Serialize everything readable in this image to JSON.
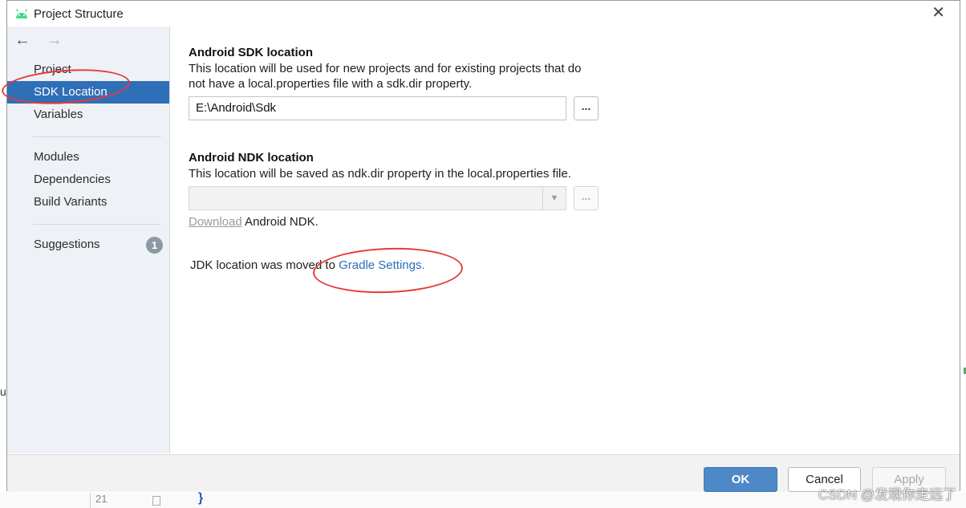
{
  "window": {
    "title": "Project Structure",
    "close_symbol": "✕"
  },
  "nav": {
    "back_symbol": "←",
    "forward_symbol": "→"
  },
  "sidebar": {
    "items": [
      {
        "label": "Project"
      },
      {
        "label": "SDK Location",
        "selected": true
      },
      {
        "label": "Variables"
      },
      {
        "label": "Modules"
      },
      {
        "label": "Dependencies"
      },
      {
        "label": "Build Variants"
      },
      {
        "label": "Suggestions",
        "badge": "1"
      }
    ]
  },
  "sdk": {
    "title": "Android SDK location",
    "desc_line1": "This location will be used for new projects and for existing projects that do",
    "desc_line2": "not have a local.properties file with a sdk.dir property.",
    "path_value": "E:\\Android\\Sdk",
    "browse_label": "..."
  },
  "ndk": {
    "title": "Android NDK location",
    "desc": "This location will be saved as ndk.dir property in the local.properties file.",
    "path_value": "",
    "browse_label": "...",
    "download_link": "Download",
    "download_suffix": " Android NDK."
  },
  "jdk": {
    "text": "JDK location was moved to ",
    "link": "Gradle Settings."
  },
  "footer": {
    "ok_label": "OK",
    "cancel_label": "Cancel",
    "apply_label": "Apply"
  },
  "watermark": "CSDN @发现你走远了",
  "edge": {
    "left_char": "u",
    "bottom_fragment": "21",
    "bottom_brace": "}"
  },
  "colors": {
    "selection": "#2f6fb7",
    "link": "#2a6fb8",
    "ok_button": "#4f88c6",
    "annotation": "#e53a3a",
    "android_green": "#3ddc84"
  }
}
